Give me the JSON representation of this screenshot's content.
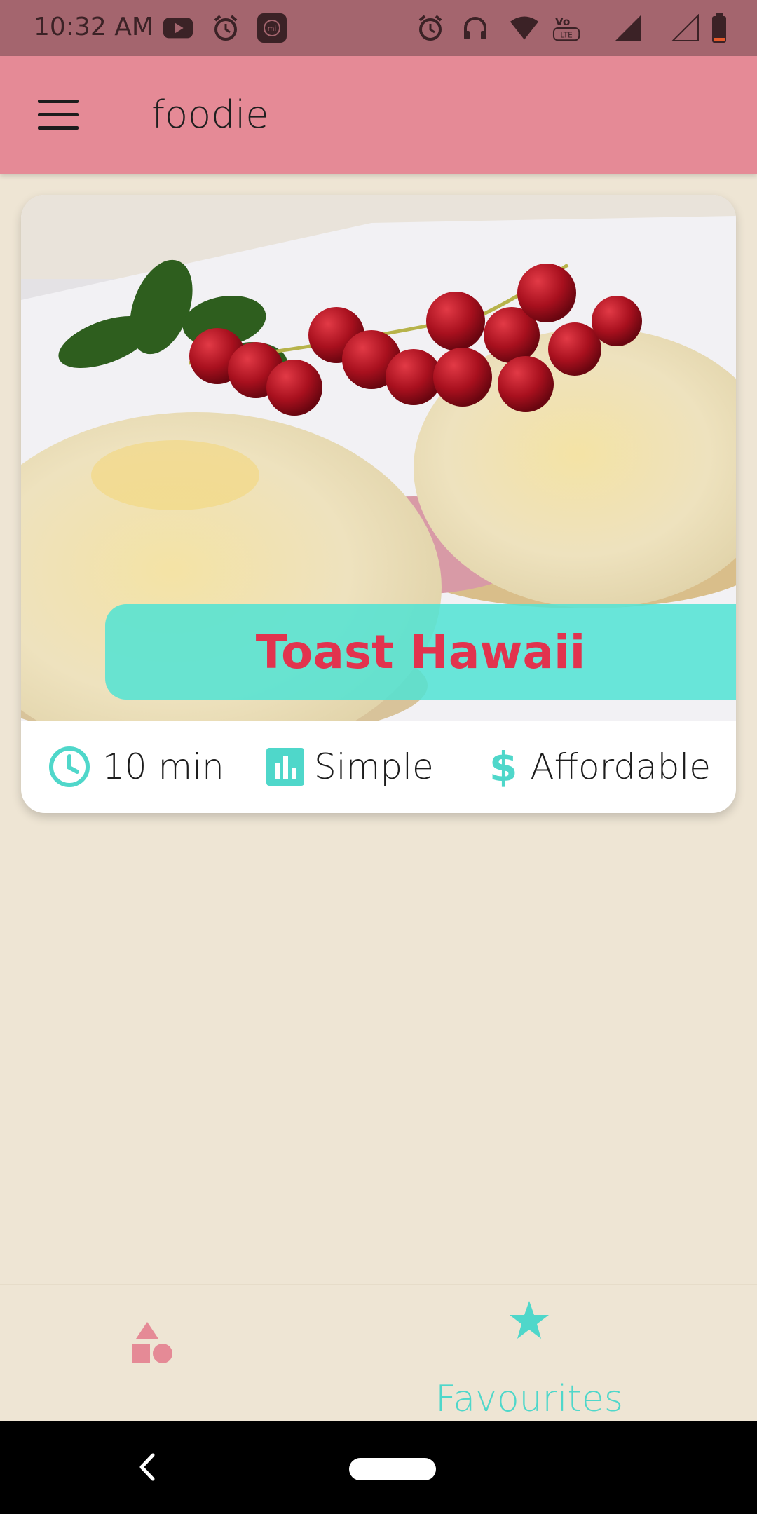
{
  "status_bar": {
    "time": "10:32 AM",
    "icons": [
      "youtube-icon",
      "alarm-icon",
      "mi-icon",
      "alarm-icon",
      "headphones-icon",
      "wifi-icon",
      "volte-icon",
      "signal-icon",
      "signal-empty-icon",
      "battery-low-icon"
    ]
  },
  "app_bar": {
    "title": "foodie"
  },
  "meal_card": {
    "title": "Toast Hawaii",
    "duration": "10 min",
    "complexity": "Simple",
    "affordability": "Affordable"
  },
  "bottom_nav": {
    "categories_icon": "categories-shapes-icon",
    "favourites_label": "Favourites"
  },
  "colors": {
    "status_bar": "#A4656E",
    "app_bar": "#E58A96",
    "background": "#EEE5D4",
    "accent": "#4FD7CA",
    "title_text": "#E2334E"
  }
}
